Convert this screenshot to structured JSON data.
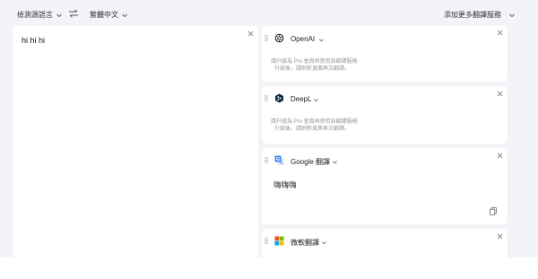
{
  "toolbar": {
    "source_lang": "檢測源語言",
    "target_lang": "繁體中文",
    "add_service": "添加更多翻譯服務"
  },
  "source": {
    "text": "hi hi hi"
  },
  "services": [
    {
      "name": "OpenAI",
      "logo": "openai-icon",
      "message_line1": "請升級為 Pro 會員再使用該翻譯服務",
      "message_line2": "升級後，請刷新頁面再次翻譯。"
    },
    {
      "name": "DeepL",
      "logo": "deepl-icon",
      "message_line1": "請升級為 Pro 會員再使用該翻譯服務",
      "message_line2": "升級後，請刷新頁面再次翻譯。"
    },
    {
      "name": "Google 翻譯",
      "logo": "google-translate-icon",
      "result": "嗨嗨嗨"
    },
    {
      "name": "微軟翻譯",
      "logo": "microsoft-icon"
    }
  ],
  "colors": {
    "background": "#f3f4f8",
    "panel": "#ffffff",
    "deepl": "#0f2b46",
    "google_blue": "#4285f4"
  }
}
